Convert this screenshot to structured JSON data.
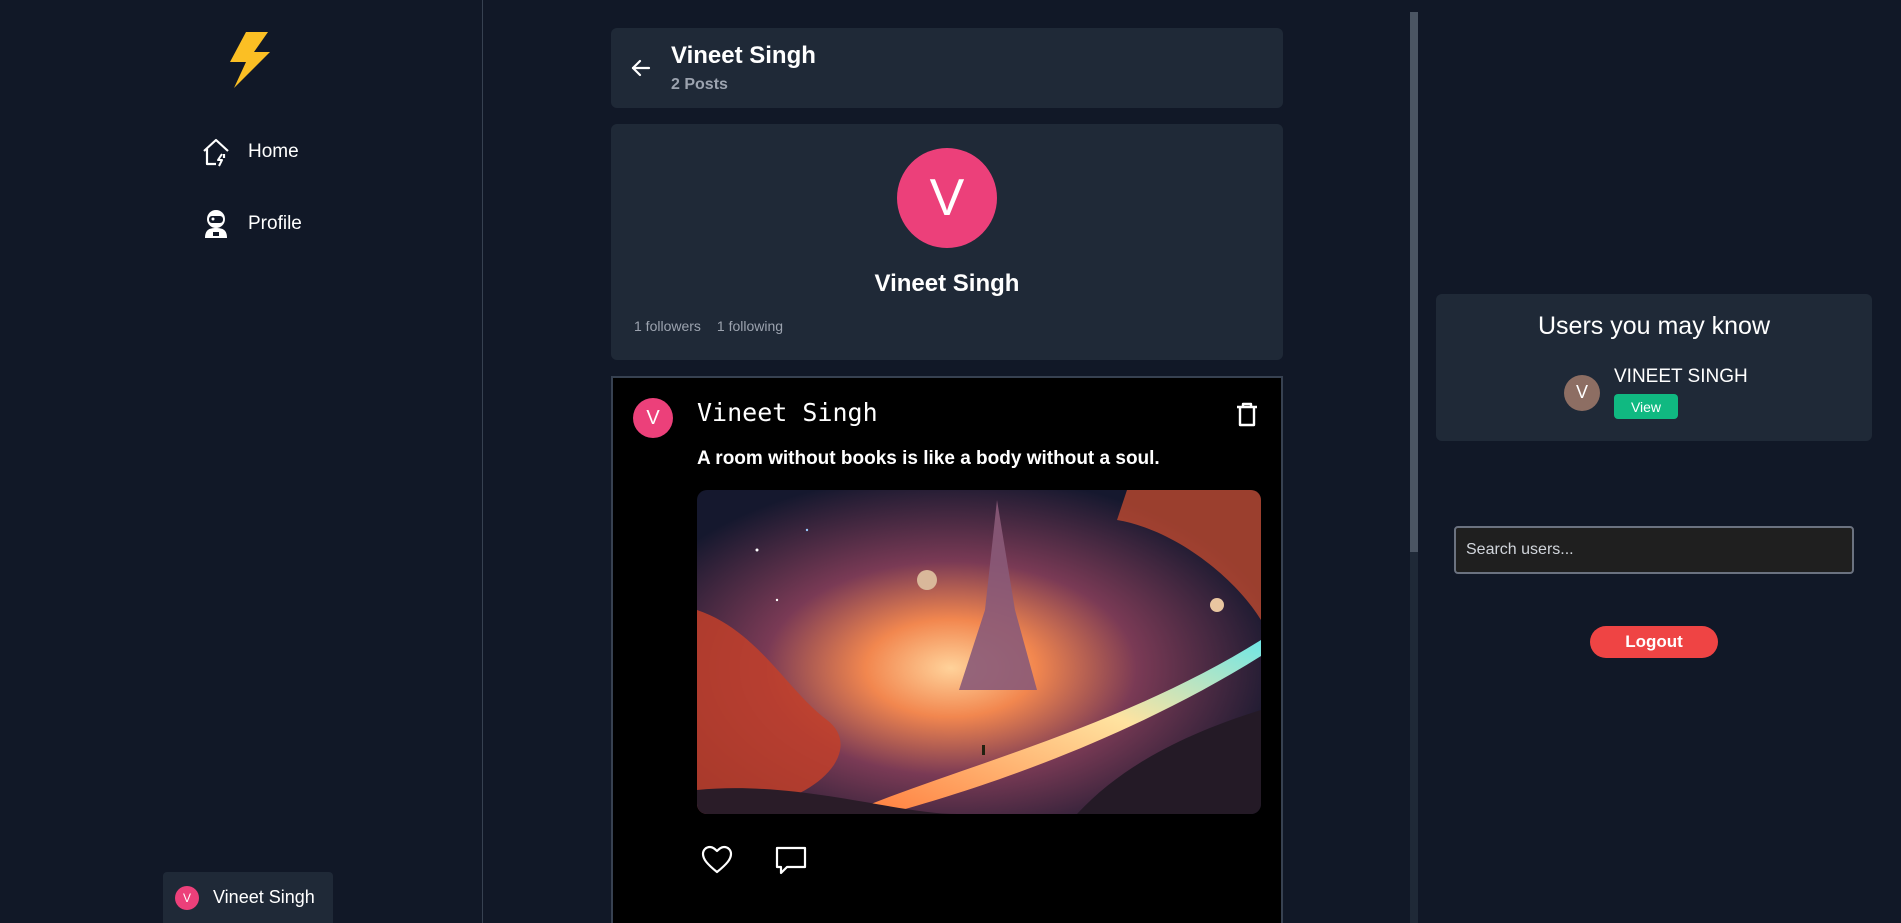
{
  "nav": {
    "home_label": "Home",
    "profile_label": "Profile"
  },
  "current_user": {
    "name": "Vineet Singh",
    "initial": "V"
  },
  "header": {
    "title": "Vineet Singh",
    "subtitle": "2 Posts"
  },
  "profile": {
    "initial": "V",
    "name": "Vineet Singh",
    "followers": "1 followers",
    "following": "1 following"
  },
  "post": {
    "initial": "V",
    "author": "Vineet Singh",
    "text": "A room without books is like a body without a soul.",
    "image_icon": "space-landscape-image"
  },
  "suggestions": {
    "title": "Users you may know",
    "users": [
      {
        "initial": "V",
        "name": "VINEET SINGH",
        "view_label": "View"
      }
    ]
  },
  "search": {
    "placeholder": "Search users..."
  },
  "logout_label": "Logout",
  "colors": {
    "background": "#111827",
    "card": "#1f2937",
    "avatar_pink": "#ec407a",
    "logo_yellow": "#fbbf24",
    "view_green": "#10b981",
    "logout_red": "#ef4444"
  }
}
